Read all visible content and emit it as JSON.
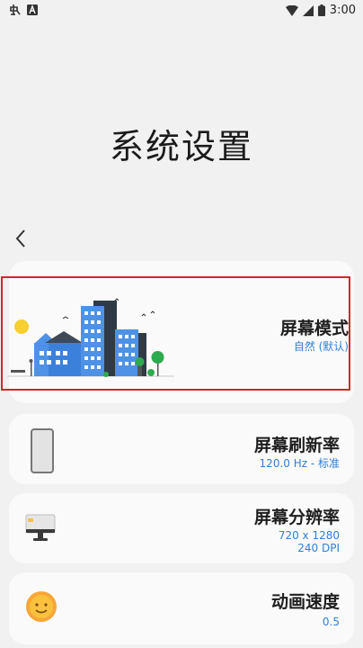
{
  "status_bar": {
    "time": "3:00",
    "left_icons": [
      "app-notification-icon",
      "font-a-icon"
    ],
    "right_icons": [
      "wifi-icon",
      "signal-icon",
      "battery-icon"
    ]
  },
  "page": {
    "title": "系统设置"
  },
  "items": [
    {
      "title": "屏幕模式",
      "value": "自然 (默认)"
    },
    {
      "title": "屏幕刷新率",
      "value": "120.0 Hz - 标准"
    },
    {
      "title": "屏幕分辨率",
      "value_line1": "720 x 1280",
      "value_line2": "240 DPI"
    },
    {
      "title": "动画速度",
      "value": "0.5"
    }
  ],
  "colors": {
    "background": "#f1f1f1",
    "card": "#fafafa",
    "accent_blue": "#2f7fd6",
    "highlight_red": "#d4242f"
  }
}
